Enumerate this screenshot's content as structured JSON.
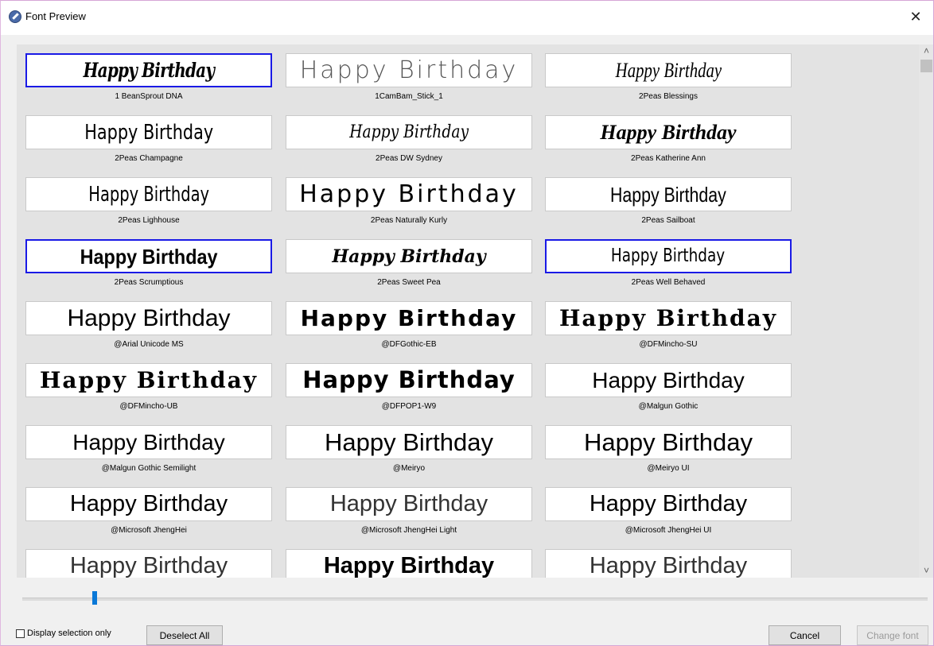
{
  "window": {
    "title": "Font Preview",
    "close_glyph": "✕",
    "app_icon": "app-icon"
  },
  "preview_text": "Happy Birthday",
  "fonts": [
    {
      "name": "1 BeanSprout DNA",
      "selected": true
    },
    {
      "name": "1CamBam_Stick_1",
      "selected": false
    },
    {
      "name": "2Peas Blessings",
      "selected": false
    },
    {
      "name": "2Peas Champagne",
      "selected": false
    },
    {
      "name": "2Peas DW Sydney",
      "selected": false
    },
    {
      "name": "2Peas Katherine Ann",
      "selected": false
    },
    {
      "name": "2Peas Lighhouse",
      "selected": false
    },
    {
      "name": "2Peas Naturally Kurly",
      "selected": false
    },
    {
      "name": "2Peas Sailboat",
      "selected": false
    },
    {
      "name": "2Peas Scrumptious",
      "selected": true
    },
    {
      "name": "2Peas Sweet Pea",
      "selected": false
    },
    {
      "name": "2Peas Well Behaved",
      "selected": true
    },
    {
      "name": "@Arial Unicode MS",
      "selected": false
    },
    {
      "name": "@DFGothic-EB",
      "selected": false
    },
    {
      "name": "@DFMincho-SU",
      "selected": false
    },
    {
      "name": "@DFMincho-UB",
      "selected": false
    },
    {
      "name": "@DFPOP1-W9",
      "selected": false
    },
    {
      "name": "@Malgun Gothic",
      "selected": false
    },
    {
      "name": "@Malgun Gothic Semilight",
      "selected": false
    },
    {
      "name": "@Meiryo",
      "selected": false
    },
    {
      "name": "@Meiryo UI",
      "selected": false
    },
    {
      "name": "@Microsoft JhengHei",
      "selected": false
    },
    {
      "name": "@Microsoft JhengHei Light",
      "selected": false
    },
    {
      "name": "@Microsoft JhengHei UI",
      "selected": false
    },
    {
      "name": "",
      "selected": false
    },
    {
      "name": "",
      "selected": false
    },
    {
      "name": "",
      "selected": false
    }
  ],
  "scrollbar": {
    "up_glyph": "˄",
    "down_glyph": "˅"
  },
  "zoom_slider": {
    "value_fraction": 0.08
  },
  "bottom": {
    "display_selection_only_label": "Display selection only",
    "display_selection_only_checked": false,
    "deselect_all_label": "Deselect All",
    "cancel_label": "Cancel",
    "change_font_label": "Change font",
    "change_font_enabled": false
  },
  "colors": {
    "selection_border": "#1a1ae6",
    "slider_thumb": "#0a78d7"
  }
}
